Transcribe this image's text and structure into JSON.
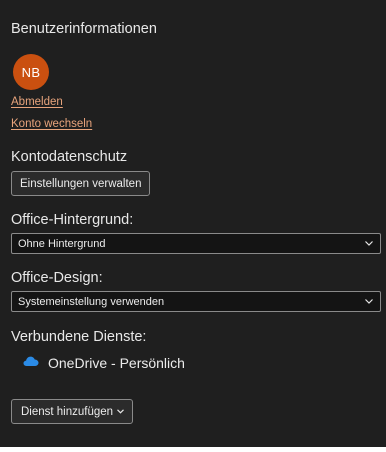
{
  "user_info": {
    "title": "Benutzerinformationen",
    "initials": "NB",
    "avatar_color": "#ca5010",
    "sign_out": "Abmelden",
    "switch_account": "Konto wechseln"
  },
  "privacy": {
    "title": "Kontodatenschutz",
    "manage_settings": "Einstellungen verwalten"
  },
  "background": {
    "title": "Office-Hintergrund:",
    "selected": "Ohne Hintergrund"
  },
  "theme": {
    "title": "Office-Design:",
    "selected": "Systemeinstellung verwenden"
  },
  "services": {
    "title": "Verbundene Dienste:",
    "items": [
      {
        "icon": "onedrive-cloud-icon",
        "label": "OneDrive - Persönlich"
      }
    ],
    "add_service": "Dienst hinzufügen"
  },
  "colors": {
    "panel_bg": "#1f1f1f",
    "link": "#e8a47c",
    "onedrive": "#2b8be6"
  }
}
